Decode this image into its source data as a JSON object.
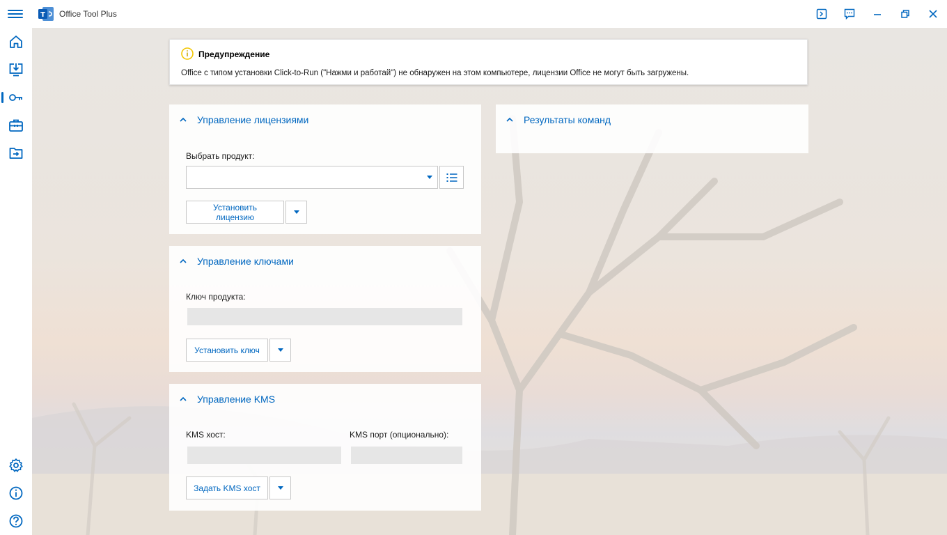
{
  "app": {
    "title": "Office Tool Plus",
    "logo_text": "T"
  },
  "colors": {
    "accent": "#0067c0",
    "warning": "#f2c600"
  },
  "titlebar_icons": [
    "console-icon",
    "feedback-icon",
    "minimize-icon",
    "restore-icon",
    "close-icon"
  ],
  "sidebar": {
    "top_items": [
      "home-icon",
      "deploy-icon",
      "activation-icon",
      "toolbox-icon",
      "convert-icon"
    ],
    "bottom_items": [
      "settings-icon",
      "about-icon",
      "help-icon"
    ],
    "active": "activation-icon"
  },
  "warning": {
    "title": "Предупреждение",
    "text": "Office с типом установки Click-to-Run (\"Нажми и работай\") не обнаружен на этом компьютере, лицензии Office не могут быть загружены."
  },
  "license": {
    "title": "Управление лицензиями",
    "product_label": "Выбрать продукт:",
    "product_value": "",
    "install_button": "Установить лицензию"
  },
  "keys": {
    "title": "Управление ключами",
    "key_label": "Ключ продукта:",
    "key_value": "",
    "install_button": "Установить ключ"
  },
  "kms": {
    "title": "Управление KMS",
    "host_label": "KMS хост:",
    "host_value": "",
    "port_label": "KMS порт (опционально):",
    "port_value": "",
    "set_button": "Задать KMS хост"
  },
  "results": {
    "title": "Результаты команд"
  }
}
